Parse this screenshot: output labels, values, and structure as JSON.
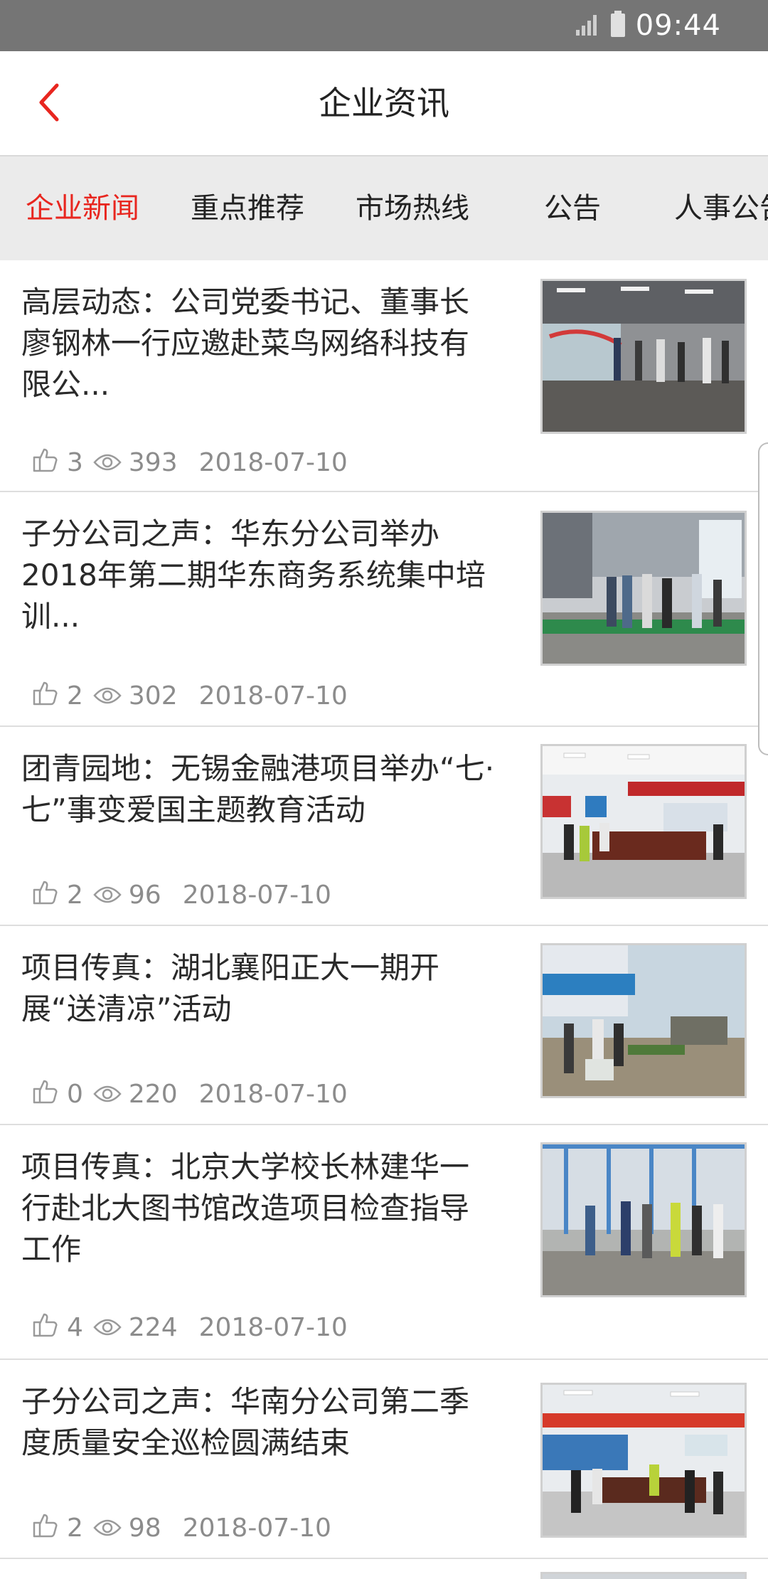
{
  "status": {
    "time": "09:44",
    "icons": [
      "signal-icon",
      "battery-icon"
    ]
  },
  "header": {
    "title": "企业资讯",
    "back_icon": "chevron-left-icon"
  },
  "colors": {
    "accent": "#e8261f",
    "status_bar": "#757575",
    "tab_bg": "#ebebeb",
    "text": "#2a2a2a",
    "meta": "#8c8c8c"
  },
  "tabs": [
    {
      "label": "企业新闻",
      "active": true
    },
    {
      "label": "重点推荐",
      "active": false
    },
    {
      "label": "市场热线",
      "active": false
    },
    {
      "label": "公告",
      "active": false
    },
    {
      "label": "人事公告",
      "active": false
    }
  ],
  "news": [
    {
      "title": "高层动态：公司党委书记、董事长廖钢林一行应邀赴菜鸟网络科技有限公...",
      "likes": "3",
      "views": "393",
      "date": "2018-07-10",
      "image": "photo-meeting-visit"
    },
    {
      "title": "子分公司之声：华东分公司举办2018年第二期华东商务系统集中培训...",
      "likes": "2",
      "views": "302",
      "date": "2018-07-10",
      "image": "photo-site-inspection"
    },
    {
      "title": "团青园地：无锡金融港项目举办“七·七”事变爱国主题教育活动",
      "likes": "2",
      "views": "96",
      "date": "2018-07-10",
      "image": "photo-conference-room"
    },
    {
      "title": "项目传真：湖北襄阳正大一期开展“送清凉”活动",
      "likes": "0",
      "views": "220",
      "date": "2018-07-10",
      "image": "photo-outdoor-site"
    },
    {
      "title": "项目传真：北京大学校长林建华一行赴北大图书馆改造项目检查指导工作",
      "likes": "4",
      "views": "224",
      "date": "2018-07-10",
      "image": "photo-workers-group"
    },
    {
      "title": "子分公司之声：华南分公司第二季度质量安全巡检圆满结束",
      "likes": "2",
      "views": "98",
      "date": "2018-07-10",
      "image": "photo-meeting-hall"
    }
  ]
}
